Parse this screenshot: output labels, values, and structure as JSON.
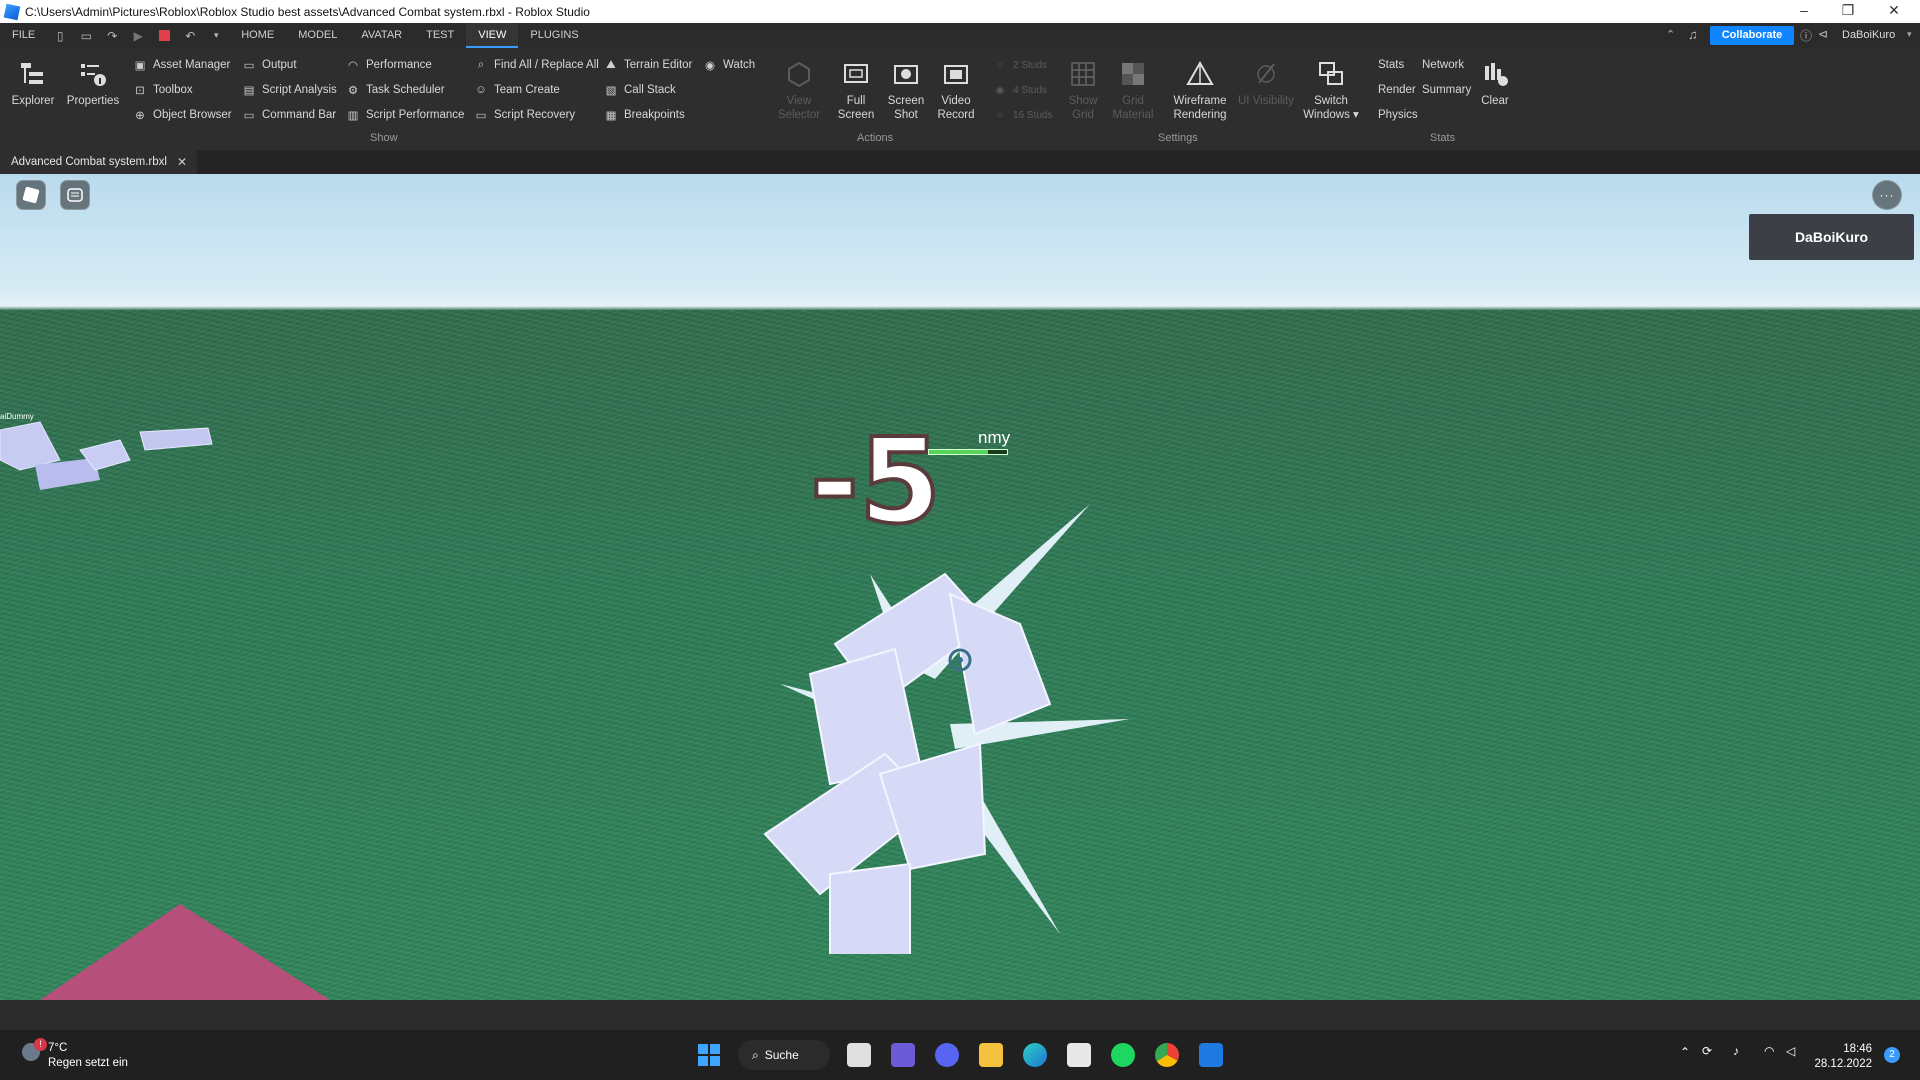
{
  "titlebar": {
    "title": "C:\\Users\\Admin\\Pictures\\Roblox\\Roblox Studio best assets\\Advanced Combat system.rbxl - Roblox Studio",
    "minimize": "–",
    "restore": "❐",
    "close": "✕"
  },
  "menubar": {
    "file": "FILE",
    "tabs": [
      "HOME",
      "MODEL",
      "AVATAR",
      "TEST",
      "VIEW",
      "PLUGINS"
    ],
    "active_tab": "VIEW",
    "collaborate": "Collaborate",
    "user": "DaBoiKuro"
  },
  "ribbon": {
    "explorer": "Explorer",
    "properties": "Properties",
    "show_items": [
      "Asset Manager",
      "Toolbox",
      "Object Browser",
      "Output",
      "Script Analysis",
      "Command Bar",
      "Performance",
      "Task Scheduler",
      "Script Performance",
      "Find All / Replace All",
      "Team Create",
      "Script Recovery",
      "Terrain Editor",
      "Call Stack",
      "Breakpoints",
      "Watch"
    ],
    "show_group": "Show",
    "view_selector": "View Selector",
    "full_screen": [
      "Full",
      "Screen"
    ],
    "screen_shot": [
      "Screen",
      "Shot"
    ],
    "video_record": [
      "Video",
      "Record"
    ],
    "actions_group": "Actions",
    "studs": [
      "2 Studs",
      "4 Studs",
      "16 Studs"
    ],
    "show_grid": [
      "Show",
      "Grid"
    ],
    "grid_material": [
      "Grid",
      "Material"
    ],
    "wireframe": [
      "Wireframe",
      "Rendering"
    ],
    "ui_visibility": "UI Visibility",
    "switch_windows": [
      "Switch",
      "Windows ▾"
    ],
    "settings_group": "Settings",
    "stats_items": [
      "Stats",
      "Render",
      "Physics",
      "Network",
      "Summary"
    ],
    "clear": "Clear",
    "stats_group": "Stats"
  },
  "doc_tab": {
    "label": "Advanced Combat system.rbxl",
    "close": "✕"
  },
  "viewport": {
    "username": "DaBoiKuro",
    "left_dummy_label": "aiDummy",
    "damage_number": "-5",
    "npc_name": "nmy",
    "npc_health": 0.75
  },
  "taskbar": {
    "weather_temp": "7°C",
    "weather_text": "Regen setzt ein",
    "search": "Suche",
    "time": "18:46",
    "date": "28.12.2022",
    "notif_count": "2"
  }
}
